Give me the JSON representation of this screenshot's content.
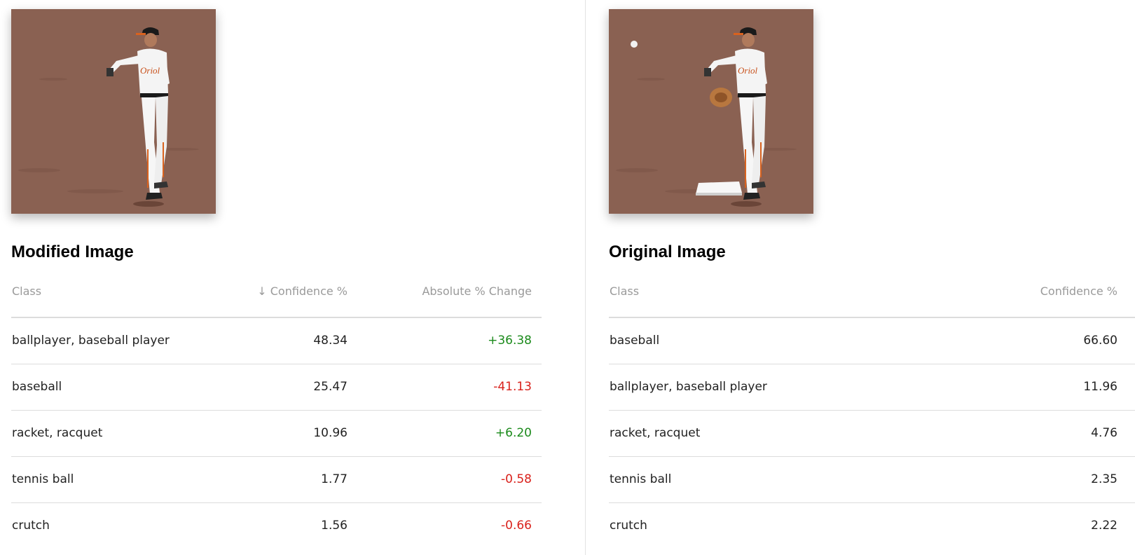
{
  "modified": {
    "title": "Modified Image",
    "image_icon": "baseball-player-photo",
    "headers": {
      "class": "Class",
      "confidence": "↓ Confidence %",
      "change": "Absolute % Change"
    },
    "rows": [
      {
        "class": "ballplayer, baseball player",
        "confidence": "48.34",
        "change": "+36.38",
        "direction": "positive"
      },
      {
        "class": "baseball",
        "confidence": "25.47",
        "change": "-41.13",
        "direction": "negative"
      },
      {
        "class": "racket, racquet",
        "confidence": "10.96",
        "change": "+6.20",
        "direction": "positive"
      },
      {
        "class": "tennis ball",
        "confidence": "1.77",
        "change": "-0.58",
        "direction": "negative"
      },
      {
        "class": "crutch",
        "confidence": "1.56",
        "change": "-0.66",
        "direction": "negative"
      }
    ]
  },
  "original": {
    "title": "Original Image",
    "image_icon": "baseball-player-photo",
    "headers": {
      "class": "Class",
      "confidence": "Confidence %"
    },
    "rows": [
      {
        "class": "baseball",
        "confidence": "66.60"
      },
      {
        "class": "ballplayer, baseball player",
        "confidence": "11.96"
      },
      {
        "class": "racket, racquet",
        "confidence": "4.76"
      },
      {
        "class": "tennis ball",
        "confidence": "2.35"
      },
      {
        "class": "crutch",
        "confidence": "2.22"
      }
    ]
  },
  "colors": {
    "positive": "#1b8a1b",
    "negative": "#d9211b",
    "header_text": "#9a9a9a",
    "dirt": "#8a6152"
  }
}
